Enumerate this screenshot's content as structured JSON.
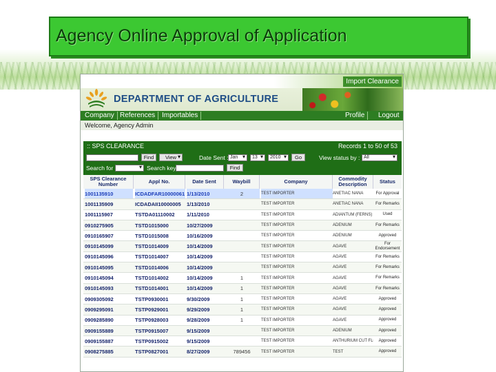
{
  "slide": {
    "title": "Agency Online Approval of Application"
  },
  "banner": {
    "import_tab": "Import Clearance",
    "department": "DEPARTMENT OF AGRICULTURE"
  },
  "nav": {
    "items": [
      "Company",
      "References",
      "Importables"
    ],
    "right_items": [
      "Profile",
      "Logout"
    ]
  },
  "welcome": "Welcome, Agency Admin",
  "sps": {
    "title": ":: SPS CLEARANCE",
    "records": "Records 1 to 50 of 53",
    "find_label": "Find",
    "view_label": "View",
    "date_sent_label": "Date Sent :",
    "date_month": "Jan",
    "date_day": "13",
    "date_year": "2010",
    "go_label": "Go",
    "view_status_label": "View status by :",
    "view_status_value": "All",
    "search_for_label": "Search for",
    "search_key_label": "Search key",
    "find2_label": "Find"
  },
  "table": {
    "headers": [
      "SPS Clearance Number",
      "Appl No.",
      "Date Sent",
      "Waybill",
      "Company",
      "Commodity Description",
      "Status"
    ],
    "rows": [
      {
        "sps": "1001135910",
        "appl": "ICDADFAR10000061",
        "date": "1/13/2010",
        "waybill": "2",
        "company": "TEST IMPORTER",
        "commodity": "ANETIAC NANA",
        "status": "For Approval",
        "highlight": true
      },
      {
        "sps": "1001135909",
        "appl": "ICDADAII10000005",
        "date": "1/13/2010",
        "waybill": "",
        "company": "TEST IMPORTER",
        "commodity": "ANETIAC NANA",
        "status": "For Remarks",
        "highlight": false
      },
      {
        "sps": "1001115907",
        "appl": "TSTDA01110002",
        "date": "1/11/2010",
        "waybill": "",
        "company": "TEST IMPORTER",
        "commodity": "ADIANTUM (FERNS)",
        "status": "Used",
        "highlight": false
      },
      {
        "sps": "0910275905",
        "appl": "TSTD1015000",
        "date": "10/27/2009",
        "waybill": "",
        "company": "TEST IMPORTER",
        "commodity": "ADENIUM",
        "status": "For Remarks",
        "highlight": false
      },
      {
        "sps": "0910165907",
        "appl": "TSTD1015008",
        "date": "10/16/2009",
        "waybill": "",
        "company": "TEST IMPORTER",
        "commodity": "ADENIUM",
        "status": "Approved",
        "highlight": false
      },
      {
        "sps": "0910145099",
        "appl": "TSTD1014009",
        "date": "10/14/2009",
        "waybill": "",
        "company": "TEST IMPORTER",
        "commodity": "AGAVE",
        "status": "For Endorsement",
        "highlight": false
      },
      {
        "sps": "0910145096",
        "appl": "TSTD1014007",
        "date": "10/14/2009",
        "waybill": "",
        "company": "TEST IMPORTER",
        "commodity": "AGAVE",
        "status": "For Remarks",
        "highlight": false
      },
      {
        "sps": "0910145095",
        "appl": "TSTD1014006",
        "date": "10/14/2009",
        "waybill": "",
        "company": "TEST IMPORTER",
        "commodity": "AGAVE",
        "status": "For Remarks",
        "highlight": false
      },
      {
        "sps": "0910145094",
        "appl": "TSTD1014002",
        "date": "10/14/2009",
        "waybill": "1",
        "company": "TEST IMPORTER",
        "commodity": "AGAVE",
        "status": "For Remarks",
        "highlight": false
      },
      {
        "sps": "0910145093",
        "appl": "TSTD1014001",
        "date": "10/14/2009",
        "waybill": "1",
        "company": "TEST IMPORTER",
        "commodity": "AGAVE",
        "status": "For Remarks",
        "highlight": false
      },
      {
        "sps": "0909305092",
        "appl": "TSTP0930001",
        "date": "9/30/2009",
        "waybill": "1",
        "company": "TEST IMPORTER",
        "commodity": "AGAVE",
        "status": "Approved",
        "highlight": false
      },
      {
        "sps": "0909295091",
        "appl": "TSTP0929001",
        "date": "9/29/2009",
        "waybill": "1",
        "company": "TEST IMPORTER",
        "commodity": "AGAVE",
        "status": "Approved",
        "highlight": false
      },
      {
        "sps": "0909285890",
        "appl": "TSTP0928003",
        "date": "9/28/2009",
        "waybill": "1",
        "company": "TEST IMPORTER",
        "commodity": "AGAVE",
        "status": "Approved",
        "highlight": false
      },
      {
        "sps": "0909155889",
        "appl": "TSTP0915007",
        "date": "9/15/2009",
        "waybill": "",
        "company": "TEST IMPORTER",
        "commodity": "ADENIUM",
        "status": "Approved",
        "highlight": false
      },
      {
        "sps": "0909155887",
        "appl": "TSTP0915002",
        "date": "9/15/2009",
        "waybill": "",
        "company": "TEST IMPORTER",
        "commodity": "ANTHURIUM CUT FLOWERS/PLANTS",
        "status": "Approved",
        "highlight": false
      },
      {
        "sps": "0908275885",
        "appl": "TSTP0827001",
        "date": "8/27/2009",
        "waybill": "789456",
        "company": "TEST IMPORTER",
        "commodity": "TEST",
        "status": "Approved",
        "highlight": false
      }
    ]
  }
}
